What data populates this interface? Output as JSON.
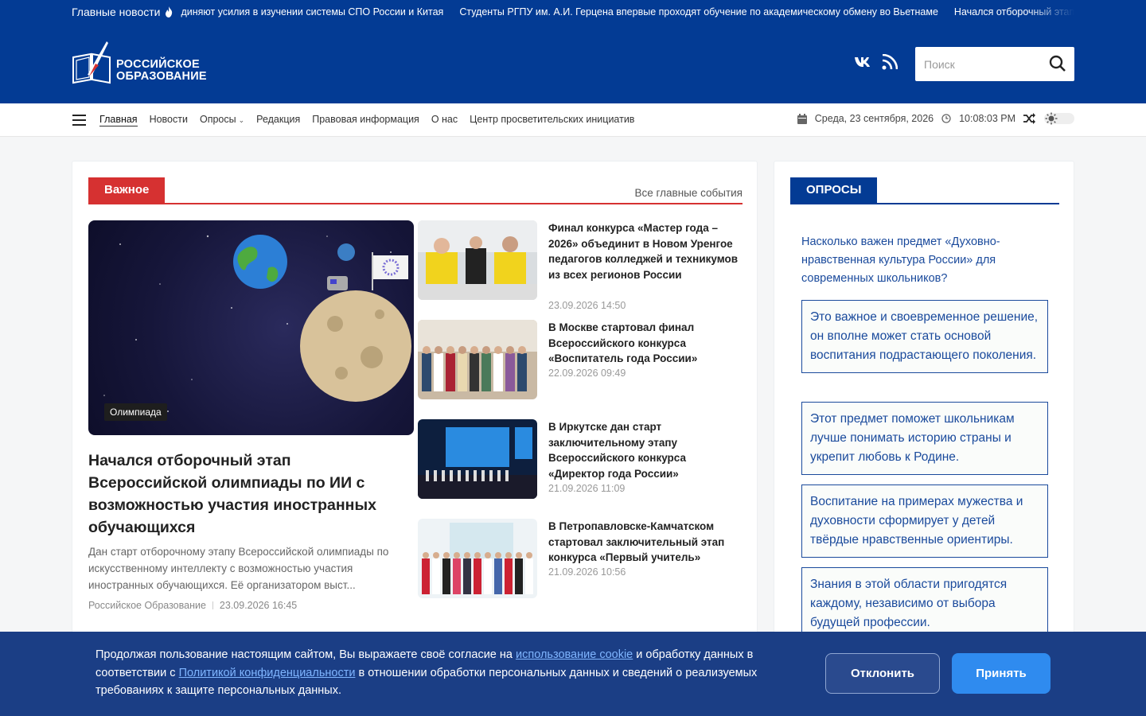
{
  "ticker": {
    "label": "Главные новости",
    "items": [
      "диняют усилия в изучении системы СПО России и Китая",
      "Студенты РГПУ им. А.И. Герцена впервые проходят обучение по академическому обмену во Вьетнаме",
      "Начался отборочный этап Всероссийской"
    ]
  },
  "header": {
    "logo_line1": "РОССИЙСКОЕ",
    "logo_line2": "ОБРАЗОВАНИЕ",
    "social": [
      "vk-icon",
      "rss-icon"
    ],
    "search_placeholder": "Поиск"
  },
  "nav": {
    "items": [
      "Главная",
      "Новости",
      "Опросы",
      "Редакция",
      "Правовая информация",
      "О нас",
      "Центр просветительских инициатив"
    ],
    "date": "Среда, 23 сентября, 2026",
    "time": "10:08:03 PM"
  },
  "main": {
    "section_tag": "Важное",
    "section_link": "Все главные события",
    "hero": {
      "badge": "Олимпиада",
      "title": "Начался отборочный этап Всероссийской олимпиады по ИИ с возможностью участия иностранных обучающихся",
      "desc": "Дан старт отборочному этапу Всероссийской олимпиады по искусственному интеллекту с возможностью участия иностранных обучающихся. Её организатором выст...",
      "author": "Российское Образование",
      "date": "23.09.2026 16:45"
    },
    "news": [
      {
        "title": "Финал конкурса «Мастер года – 2026» объединит в Новом Уренгое педагогов колледжей и техникумов из всех регионов России",
        "date": "23.09.2026 14:50"
      },
      {
        "title": "В Москве стартовал финал Всероссийского конкурса «Воспитатель года России»",
        "date": "22.09.2026 09:49"
      },
      {
        "title": "В Иркутске дан старт заключительному этапу Всероссийского конкурса «Директор года России»",
        "date": "21.09.2026 11:09"
      },
      {
        "title": "В Петропавловске-Камчатском стартовал заключительный этап конкурса «Первый учитель»",
        "date": "21.09.2026 10:56"
      }
    ]
  },
  "poll": {
    "tag": "ОПРОСЫ",
    "question": "Насколько важен предмет «Духовно-нравственная культура России» для современных школьников?",
    "options": [
      "Это важное и своевременное решение, он вполне может стать основой воспитания подрастающего поколения.",
      "Этот предмет поможет школьникам лучше понимать историю страны и укрепит любовь к Родине.",
      "Воспитание на примерах мужества и духовности сформирует у детей твёрдые нравственные ориентиры.",
      "Знания в этой области пригодятся каждому, независимо от выбора будущей профессии."
    ]
  },
  "cookie": {
    "text1": "Продолжая пользование настоящим сайтом, Вы выражаете своё согласие на ",
    "link1": "использование cookie",
    "text2": " и обработку данных в соответствии с ",
    "link2": "Политикой конфиденциальности",
    "text3": " в отношении обработки персональных данных и сведений о реализуемых требованиях к защите персональных данных.",
    "reject": "Отклонить",
    "accept": "Принять"
  },
  "colors": {
    "brand": "#033b94",
    "accent_red": "#d63131",
    "accept_button": "#2f8bef"
  }
}
